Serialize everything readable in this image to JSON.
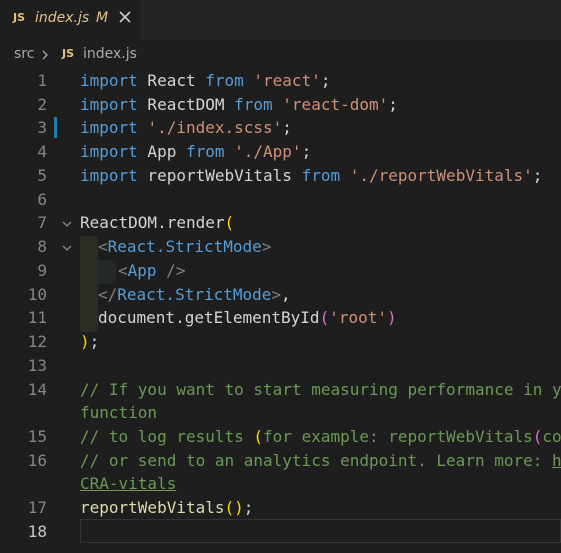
{
  "tab": {
    "icon_label": "JS",
    "filename": "index.js",
    "status": "M"
  },
  "breadcrumb": {
    "folder": "src",
    "icon_label": "JS",
    "file": "index.js"
  },
  "editor": {
    "line_numbers": [
      "1",
      "2",
      "3",
      "4",
      "5",
      "6",
      "7",
      "8",
      "9",
      "10",
      "11",
      "12",
      "13",
      "14",
      "15",
      "16",
      "17",
      "18"
    ],
    "lines": {
      "l1": {
        "a": "import",
        "b": " React ",
        "c": "from",
        "d": " 'react'",
        "e": ";"
      },
      "l2": {
        "a": "import",
        "b": " ReactDOM ",
        "c": "from",
        "d": " 'react-dom'",
        "e": ";"
      },
      "l3": {
        "a": "import",
        "b": " ",
        "d": "'./index.scss'",
        "e": ";"
      },
      "l4": {
        "a": "import",
        "b": " App ",
        "c": "from",
        "d": " './App'",
        "e": ";"
      },
      "l5": {
        "a": "import",
        "b": " reportWebVitals ",
        "c": "from",
        "d": " './reportWebVitals'",
        "e": ";"
      },
      "l7": {
        "a": "ReactDOM",
        "b": ".",
        "c": "render",
        "d": "("
      },
      "l8": {
        "a": "<",
        "b": "React.StrictMode",
        "c": ">"
      },
      "l9": {
        "a": "<",
        "b": "App",
        "c": " />"
      },
      "l10": {
        "a": "</",
        "b": "React.StrictMode",
        "c": ">",
        ",": ","
      },
      "l11": {
        "a": "document",
        "b": ".",
        "c": "getElementById",
        "d": "(",
        "e": "'root'",
        "f": ")"
      },
      "l12": {
        "a": ")",
        "b": ";"
      },
      "l14a": "// If you want to start measuring performance in y",
      "l14b": "function",
      "l15a": "// to log results ",
      "l15b": "(",
      "l15c": "for example: reportWebVitals",
      "l15d": "(",
      "l15e": "co",
      "l16a": "// or send to an analytics endpoint. Learn more: ",
      "l16b": "h",
      "l16c": "CRA-vitals",
      "l17": {
        "a": "reportWebVitals",
        "b": "(",
        ")": ")",
        "c": ";"
      }
    }
  },
  "colors": {
    "background": "#1e1e1e",
    "keyword": "#569cd6",
    "string": "#ce9178",
    "comment": "#6a9955",
    "function": "#dcdcaa",
    "modified": "#e2c08d"
  }
}
